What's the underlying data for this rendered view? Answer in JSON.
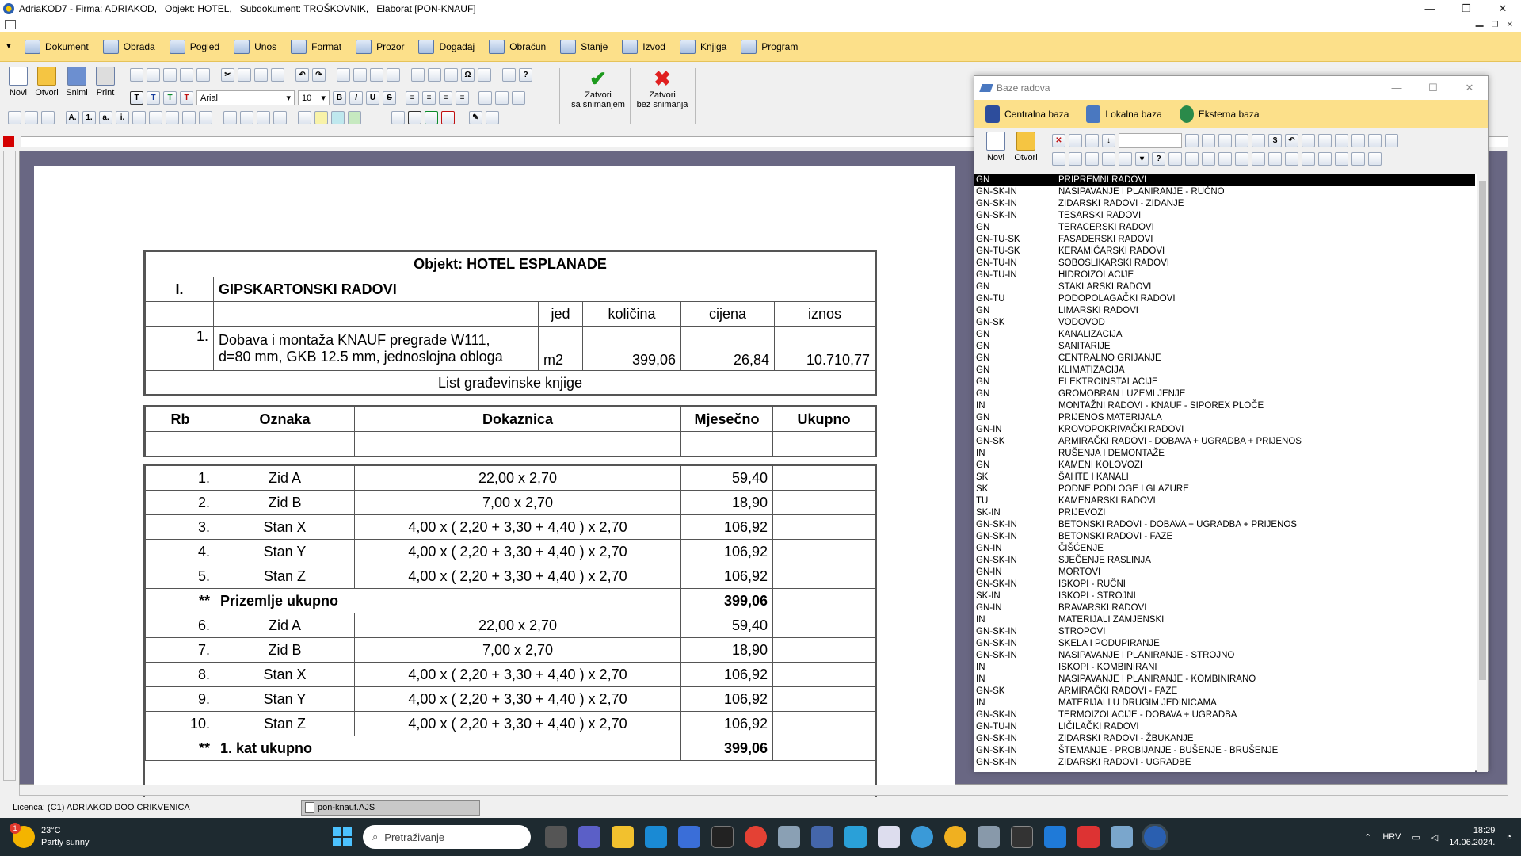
{
  "window": {
    "title": "AdriaKOD7 - Firma: ADRIAKOD,   Objekt: HOTEL,   Subdokument: TROŠKOVNIK,   Elaborat [PON-KNAUF]",
    "min": "—",
    "max": "❐",
    "close": "✕"
  },
  "menu": [
    "Dokument",
    "Obrada",
    "Pogled",
    "Unos",
    "Format",
    "Prozor",
    "Događaj",
    "Obračun",
    "Stanje",
    "Izvod",
    "Knjiga",
    "Program"
  ],
  "toolbar": {
    "new": "Novi",
    "open": "Otvori",
    "save": "Snimi",
    "print": "Print",
    "font": "Arial",
    "size": "10",
    "close_save": [
      "Zatvori",
      "sa snimanjem"
    ],
    "close_nosave": [
      "Zatvori",
      "bez snimanja"
    ]
  },
  "document": {
    "header": {
      "title": "Objekt: HOTEL ESPLANADE",
      "section_no": "I.",
      "section": "GIPSKARTONSKI RADOVI",
      "cols": [
        "jed",
        "količina",
        "cijena",
        "iznos"
      ],
      "item_no": "1.",
      "item_desc": [
        "Dobava i montaža KNAUF pregrade W111,",
        "d=80 mm, GKB 12.5 mm, jednoslojna obloga"
      ],
      "unit": "m2",
      "qty": "399,06",
      "price": "26,84",
      "amount": "10.710,77",
      "sheet": "List građevinske knjige"
    },
    "cols2": [
      "Rb",
      "Oznaka",
      "Dokaznica",
      "Mjesečno",
      "Ukupno"
    ],
    "rows": [
      {
        "rb": "1.",
        "oz": "Zid A",
        "dok": "22,00 x 2,70",
        "mj": "59,40"
      },
      {
        "rb": "2.",
        "oz": "Zid B",
        "dok": "7,00 x 2,70",
        "mj": "18,90"
      },
      {
        "rb": "3.",
        "oz": "Stan X",
        "dok": "4,00 x ( 2,20 + 3,30 + 4,40 ) x 2,70",
        "mj": "106,92"
      },
      {
        "rb": "4.",
        "oz": "Stan Y",
        "dok": "4,00 x ( 2,20 + 3,30 + 4,40 ) x 2,70",
        "mj": "106,92"
      },
      {
        "rb": "5.",
        "oz": "Stan Z",
        "dok": "4,00 x ( 2,20 + 3,30 + 4,40 ) x 2,70",
        "mj": "106,92"
      },
      {
        "sum": true,
        "mark": "**",
        "label": "Prizemlje ukupno",
        "mj": "399,06"
      },
      {
        "rb": "6.",
        "oz": "Zid A",
        "dok": "22,00 x 2,70",
        "mj": "59,40"
      },
      {
        "rb": "7.",
        "oz": "Zid B",
        "dok": "7,00 x 2,70",
        "mj": "18,90"
      },
      {
        "rb": "8.",
        "oz": "Stan X",
        "dok": "4,00 x ( 2,20 + 3,30 + 4,40 ) x 2,70",
        "mj": "106,92"
      },
      {
        "rb": "9.",
        "oz": "Stan Y",
        "dok": "4,00 x ( 2,20 + 3,30 + 4,40 ) x 2,70",
        "mj": "106,92"
      },
      {
        "rb": "10.",
        "oz": "Stan Z",
        "dok": "4,00 x ( 2,20 + 3,30 + 4,40 ) x 2,70",
        "mj": "106,92"
      },
      {
        "sum": true,
        "mark": "**",
        "label": "1. kat ukupno",
        "mj": "399,06"
      }
    ]
  },
  "baze": {
    "title": "Baze radova",
    "tabs": [
      "Centralna baza",
      "Lokalna baza",
      "Eksterna baza"
    ],
    "tb_new": "Novi",
    "tb_open": "Otvori",
    "items": [
      [
        "GN",
        "PRIPREMNI RADOVI"
      ],
      [
        "GN-SK-IN",
        "NASIPAVANJE I PLANIRANJE - RUČNO"
      ],
      [
        "GN-SK-IN",
        "ZIDARSKI RADOVI - ZIDANJE"
      ],
      [
        "GN-SK-IN",
        "TESARSKI RADOVI"
      ],
      [
        "GN",
        "TERACERSKI RADOVI"
      ],
      [
        "GN-TU-SK",
        "FASADERSKI RADOVI"
      ],
      [
        "GN-TU-SK",
        "KERAMIČARSKI RADOVI"
      ],
      [
        "GN-TU-IN",
        "SOBOSLIKARSKI RADOVI"
      ],
      [
        "GN-TU-IN",
        "HIDROIZOLACIJE"
      ],
      [
        "GN",
        "STAKLARSKI RADOVI"
      ],
      [
        "GN-TU",
        "PODOPOLAGAČKI RADOVI"
      ],
      [
        "GN",
        "LIMARSKI RADOVI"
      ],
      [
        "GN-SK",
        "VODOVOD"
      ],
      [
        "GN",
        "KANALIZACIJA"
      ],
      [
        "GN",
        "SANITARIJE"
      ],
      [
        "GN",
        "CENTRALNO GRIJANJE"
      ],
      [
        "GN",
        "KLIMATIZACIJA"
      ],
      [
        "GN",
        "ELEKTROINSTALACIJE"
      ],
      [
        "GN",
        "GROMOBRAN I UZEMLJENJE"
      ],
      [
        "IN",
        "MONTAŽNI RADOVI - KNAUF - SIPOREX PLOČE"
      ],
      [
        "GN",
        "PRIJENOS MATERIJALA"
      ],
      [
        "GN-IN",
        "KROVOPOKRIVAČKI RADOVI"
      ],
      [
        "GN-SK",
        "ARMIRAČKI RADOVI - DOBAVA + UGRADBA + PRIJENOS"
      ],
      [
        "IN",
        "RUŠENJA I DEMONTAŽE"
      ],
      [
        "GN",
        "KAMENI KOLOVOZI"
      ],
      [
        "SK",
        "ŠAHTE I KANALI"
      ],
      [
        "SK",
        "PODNE PODLOGE I GLAZURE"
      ],
      [
        "TU",
        "KAMENARSKI RADOVI"
      ],
      [
        "SK-IN",
        "PRIJEVOZI"
      ],
      [
        "GN-SK-IN",
        "BETONSKI RADOVI - DOBAVA + UGRADBA + PRIJENOS"
      ],
      [
        "GN-SK-IN",
        "BETONSKI RADOVI - FAZE"
      ],
      [
        "GN-IN",
        "ČIŠĆENJE"
      ],
      [
        "GN-SK-IN",
        "SJEČENJE RASLINJA"
      ],
      [
        "GN-IN",
        "MORTOVI"
      ],
      [
        "GN-SK-IN",
        "ISKOPI - RUČNI"
      ],
      [
        "SK-IN",
        "ISKOPI - STROJNI"
      ],
      [
        "GN-IN",
        "BRAVARSKI RADOVI"
      ],
      [
        "IN",
        "MATERIJALI ZAMJENSKI"
      ],
      [
        "GN-SK-IN",
        "STROPOVI"
      ],
      [
        "GN-SK-IN",
        "SKELA I PODUPIRANJE"
      ],
      [
        "GN-SK-IN",
        "NASIPAVANJE I PLANIRANJE - STROJNO"
      ],
      [
        "IN",
        "ISKOPI - KOMBINIRANI"
      ],
      [
        "IN",
        "NASIPAVANJE I PLANIRANJE - KOMBINIRANO"
      ],
      [
        "GN-SK",
        "ARMIRAČKI RADOVI - FAZE"
      ],
      [
        "IN",
        "MATERIJALI U DRUGIM JEDINICAMA"
      ],
      [
        "GN-SK-IN",
        "TERMOIZOLACIJE - DOBAVA + UGRADBA"
      ],
      [
        "GN-TU-IN",
        "LIČILAČKI RADOVI"
      ],
      [
        "GN-SK-IN",
        "ZIDARSKI RADOVI - ŽBUKANJE"
      ],
      [
        "GN-SK-IN",
        "ŠTEMANJE - PROBIJANJE - BUŠENJE - BRUŠENJE"
      ],
      [
        "GN-SK-IN",
        "ZIDARSKI RADOVI - UGRADBE"
      ]
    ]
  },
  "status": {
    "license": "Licenca:  (C1) ADRIAKOD DOO CRIKVENICA",
    "file": "pon-knauf.AJS"
  },
  "taskbar": {
    "temp": "23°C",
    "weather": "Partly sunny",
    "badge": "1",
    "search": "Pretraživanje",
    "lang": "HRV",
    "time": "18:29",
    "date": "14.06.2024."
  }
}
